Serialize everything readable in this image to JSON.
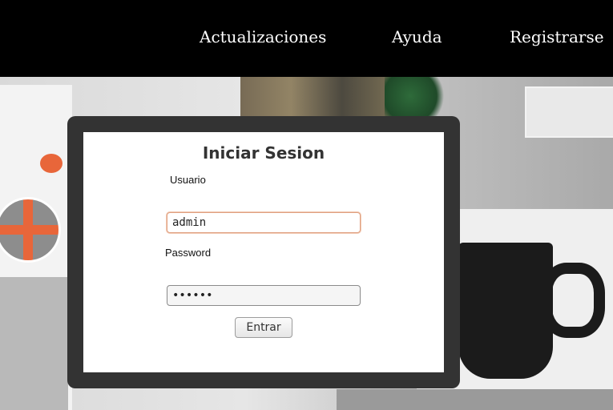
{
  "nav": {
    "items": [
      {
        "label": "Actualizaciones"
      },
      {
        "label": "Ayuda"
      },
      {
        "label": "Registrarse"
      }
    ]
  },
  "login": {
    "title": "Iniciar Sesion",
    "username_label": "Usuario",
    "username_value": "admin",
    "password_label": "Password",
    "password_value": "••••••",
    "submit_label": "Entrar"
  },
  "colors": {
    "nav_background": "#000000",
    "panel_frame": "#333333",
    "accent_orange": "#e8663a"
  }
}
